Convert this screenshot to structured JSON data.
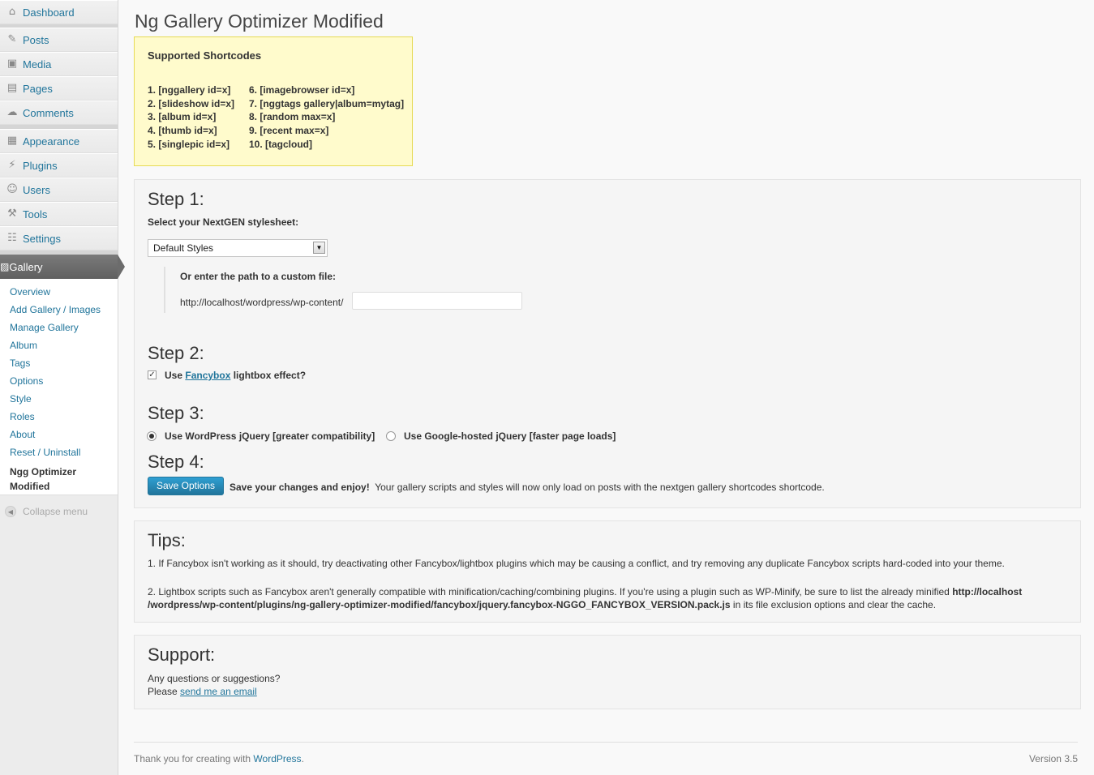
{
  "sidebar": {
    "menu": [
      {
        "label": "Dashboard",
        "icon": "dashboard-icon",
        "glyph": "⌂"
      },
      {
        "label": "Posts",
        "icon": "pushpin-icon",
        "glyph": "✎"
      },
      {
        "label": "Media",
        "icon": "media-icon",
        "glyph": "▣"
      },
      {
        "label": "Pages",
        "icon": "pages-icon",
        "glyph": "▤"
      },
      {
        "label": "Comments",
        "icon": "comments-icon",
        "glyph": "☁"
      },
      {
        "label": "Appearance",
        "icon": "appearance-icon",
        "glyph": "▦"
      },
      {
        "label": "Plugins",
        "icon": "plugins-icon",
        "glyph": "⚡"
      },
      {
        "label": "Users",
        "icon": "users-icon",
        "glyph": "☺"
      },
      {
        "label": "Tools",
        "icon": "tools-icon",
        "glyph": "⚒"
      },
      {
        "label": "Settings",
        "icon": "settings-icon",
        "glyph": "☷"
      }
    ],
    "gallery": {
      "label": "Gallery",
      "icon": "gallery-icon",
      "glyph": "▨"
    },
    "submenu": [
      "Overview",
      "Add Gallery / Images",
      "Manage Gallery",
      "Album",
      "Tags",
      "Options",
      "Style",
      "Roles",
      "About",
      "Reset / Uninstall"
    ],
    "current_sub": {
      "line1": "Ngg Optimizer",
      "line2": "Modified"
    },
    "collapse_label": "Collapse menu"
  },
  "page": {
    "title": "Ng Gallery Optimizer Modified"
  },
  "shortcodes": {
    "title": "Supported Shortcodes",
    "col1": [
      "1. [nggallery id=x]",
      "2. [slideshow id=x]",
      "3. [album id=x]",
      "4. [thumb id=x]",
      "5. [singlepic id=x]"
    ],
    "col2": [
      "6. [imagebrowser id=x]",
      "7. [nggtags gallery|album=mytag]",
      "8. [random max=x]",
      "9. [recent max=x]",
      "10. [tagcloud]"
    ]
  },
  "step1": {
    "heading": "Step 1:",
    "label": "Select your NextGEN stylesheet:",
    "selected": "Default Styles",
    "custom_label": "Or enter the path to a custom file:",
    "path_prefix": "http://localhost/wordpress/wp-content/",
    "custom_value": ""
  },
  "step2": {
    "heading": "Step 2:",
    "prefix": "Use",
    "link": "Fancybox",
    "suffix": "lightbox effect?",
    "checked": true
  },
  "step3": {
    "heading": "Step 3:",
    "option1": "Use WordPress jQuery [greater compatibility]",
    "option2": "Use Google-hosted jQuery [faster page loads]",
    "selected": 1
  },
  "step4": {
    "heading": "Step 4:",
    "button": "Save Options",
    "bold_text": "Save your changes and enjoy!",
    "text": "Your gallery scripts and styles will now only load on posts with the nextgen gallery shortcodes shortcode."
  },
  "tips": {
    "heading": "Tips:",
    "tip1": "1. If Fancybox isn't working as it should, try deactivating other Fancybox/lightbox plugins which may be causing a conflict, and try removing any duplicate Fancybox scripts hard-coded into your theme.",
    "tip2_prefix": "2. Lightbox scripts such as Fancybox aren't generally compatible with minification/caching/combining plugins. If you're using a plugin such as WP-Minify, be sure to list the already minified",
    "tip2_path1": "http://localhost",
    "tip2_path2": "/wordpress/wp-content/plugins/ng-gallery-optimizer-modified/fancybox/jquery.fancybox-NGGO_FANCYBOX_VERSION.pack.js",
    "tip2_suffix": "in its file exclusion options and clear the cache."
  },
  "support": {
    "heading": "Support:",
    "line1": "Any questions or suggestions?",
    "line2_prefix": "Please",
    "link": "send me an email"
  },
  "footer": {
    "prefix": "Thank you for creating with",
    "link": "WordPress",
    "suffix": ".",
    "version": "Version 3.5"
  },
  "colors": {
    "link": "#21759b",
    "notice_bg": "#fffbcc",
    "button": "#21759b"
  }
}
